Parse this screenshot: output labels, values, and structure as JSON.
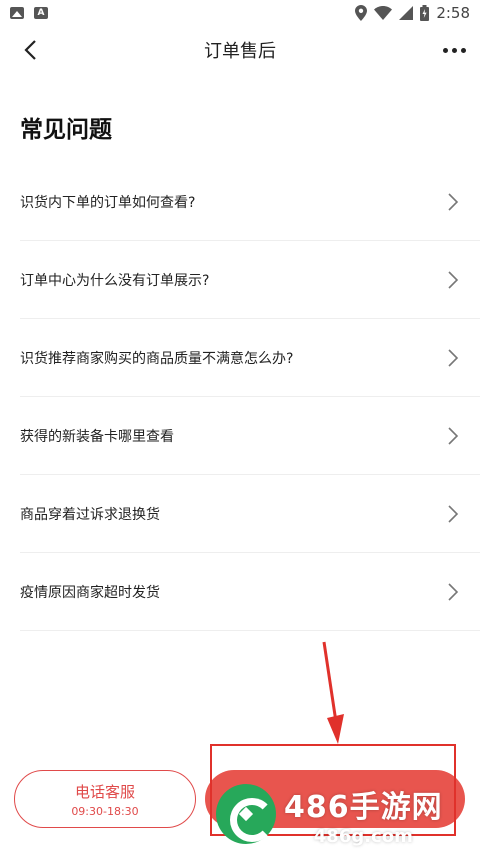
{
  "status_bar": {
    "left_icons": [
      "image-icon",
      "font-icon"
    ],
    "right_icons": [
      "location-icon",
      "wifi-icon",
      "signal-icon",
      "battery-icon"
    ],
    "time": "2:58"
  },
  "nav": {
    "title": "订单售后",
    "back_icon": "chevron-left-icon",
    "more_icon": "more-dots-icon"
  },
  "faq": {
    "title": "常见问题",
    "items": [
      {
        "question": "识货内下单的订单如何查看?"
      },
      {
        "question": "订单中心为什么没有订单展示?"
      },
      {
        "question": "识货推荐商家购买的商品质量不满意怎么办?"
      },
      {
        "question": "获得的新装备卡哪里查看"
      },
      {
        "question": "商品穿着过诉求退换货"
      },
      {
        "question": "疫情原因商家超时发货"
      }
    ]
  },
  "bottom": {
    "phone_label": "电话客服",
    "phone_hours": "09:30-18:30"
  },
  "colors": {
    "accent": "#e04a4a",
    "highlight_box": "#e0312b",
    "watermark_green": "#27a85a"
  },
  "watermark": {
    "main": "486手游网",
    "sub": "486g.com"
  }
}
